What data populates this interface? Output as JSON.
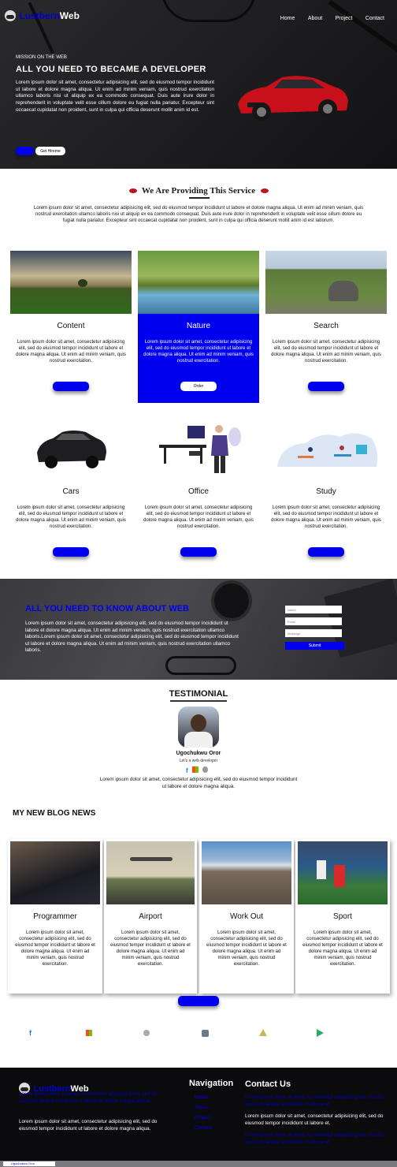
{
  "brand": {
    "part1": "Lustbern",
    "part2": "Web"
  },
  "nav": {
    "items": [
      "Home",
      "About",
      "Project",
      "Contact"
    ]
  },
  "hero": {
    "eyebrow": "MISSION ON THE WEB",
    "title": "ALL YOU NEED TO BECAME A DEVELOPER",
    "paragraph": "Lorem ipsum dolor sit amet, consectetur adipisicing elit, sed do eiusmod tempor incididunt ut labore et dolore magna aliqua. Ut enim ad minim veniam, quis nostrud exercitation ullamco laboris nisi ut aliquip ex ea commodo consequat. Duis aute irure dolor in reprehenderit in voluptate velit esse cillum dolore eu fugiat nulla pariatur. Excepteur sint occaecat cupidatat non proident, sunt in culpa qui officia deserunt mollit anim id est.",
    "secondary_button": "Get Hireme"
  },
  "services": {
    "title": "We Are Providing This Service",
    "intro": "Lorem ipsum dolor sit amet, consectetur adipisicing elit, sed do eiusmod tempor incididunt ut labore et dolore magna aliqua. Ut enim ad minim veniam, quis nostrud exercitation ullamco laboris nisi ut aliquip ex ea commodo consequat. Duis aute irure dolor in reprehenderit in voluptate velit esse cillum dolore eu fugiat nulla pariatur. Excepteur sint occaecat cupidatat non proident, sunt in culpa qui officia deserunt mollit anim id est laborum.",
    "cards": [
      {
        "title": "Content",
        "text": "Lorem ipsum dolor sit amet, consectetur adipisicing elit, sed do eiusmod tempor incididunt ut labore et dolore magna aliqua. Ut enim ad minim veniam, quis nostrud exercitation."
      },
      {
        "title": "Nature",
        "text": "Lorem ipsum dolor sit amet, consectetur adipisicing elit, sed do eiusmod tempor incididunt ut labore et dolore magna aliqua. Ut enim ad minim veniam, quis nostrud exercitation.",
        "button": "Order"
      },
      {
        "title": "Search",
        "text": "Lorem ipsum dolor sit amet, consectetur adipisicing elit, sed do eiusmod tempor incididunt ut labore et dolore magna aliqua. Ut enim ad minim veniam, quis nostrud exercitation."
      },
      {
        "title": "Cars",
        "text": "Lorem ipsum dolor sit amet, consectetur adipisicing elit, sed do eiusmod tempor incididunt ut labore et dolore magna aliqua. Ut enim ad minim veniam, quis nostrud exercitation."
      },
      {
        "title": "Office",
        "text": "Lorem ipsum dolor sit amet, consectetur adipisicing elit, sed do eiusmod tempor incididunt ut labore et dolore magna aliqua. Ut enim ad minim veniam, quis nostrud exercitation."
      },
      {
        "title": "Study",
        "text": "Lorem ipsum dolor sit amet, consectetur adipisicing elit, sed do eiusmod tempor incididunt ut labore et dolore magna aliqua. Ut enim ad minim veniam, quis nostrud exercitation."
      }
    ]
  },
  "know": {
    "title": "ALL YOU NEED TO KNOW ABOUT WEB",
    "paragraph": "Lorem ipsum dolor sit amet, consectetur adipisicing elit, sed do eiusmod tempor incididunt ut labore et dolore magna aliqua. Ut enim ad minim veniam, quis nostrud exercitation ullamco laboris.Lorem ipsum dolor sit amet, consectetur adipisicing elit, sed do eiusmod tempor incididunt ut labore et dolore magna aliqua. Ut enim ad minim veniam, quis nostrud exercitation ullamco laboris.",
    "form": {
      "field1": "Name",
      "field2": "Email",
      "field3": "Message",
      "submit": "Submit"
    }
  },
  "testimonial": {
    "title": "TESTIMONIAL",
    "name": "Ugochukwu Oror",
    "role": "Let's a web developer",
    "quote": "Lorem ipsum dolor sit amet, consectetur adipisicing elit, sed do eiusmod tempor incididunt ut labore et dolore magna aliqua."
  },
  "blog": {
    "title": "MY NEW BLOG NEWS",
    "cards": [
      {
        "title": "Programmer",
        "text": "Lorem ipsum dolor sit amet, consectetur adipisicing elit, sed do eiusmod tempor incididunt ut labore et dolore magna aliqua. Ut enim ad minim veniam, quis nostrud exercitation."
      },
      {
        "title": "Airport",
        "text": "Lorem ipsum dolor sit amet, consectetur adipisicing elit, sed do eiusmod tempor incididunt ut labore et dolore magna aliqua. Ut enim ad minim veniam, quis nostrud exercitation."
      },
      {
        "title": "Work Out",
        "text": "Lorem ipsum dolor sit amet, consectetur adipisicing elit, sed do eiusmod tempor incididunt ut labore et dolore magna aliqua. Ut enim ad minim veniam, quis nostrud exercitation."
      },
      {
        "title": "Sport",
        "text": "Lorem ipsum dolor sit amet, consectetur adipisicing elit, sed do eiusmod tempor incididunt ut labore et dolore magna aliqua. Ut enim ad minim veniam, quis nostrud exercitation."
      }
    ]
  },
  "footer": {
    "about_dim": "Lorem ipsum dolor sit amet, consectetur adipisicing elit, sed do eiusmod tempor incididunt ut labore et dolore magna aliqua.",
    "about": "Lorem ipsum dolor sit amet, consectetur adipisicing elit, sed do eiusmod tempor incididunt ut labore et dolore magna aliqua.",
    "nav_title": "Navigation",
    "nav_items": [
      "Home",
      "About",
      "Project",
      "Contact"
    ],
    "contact_title": "Contact Us",
    "contact_dim1": "Lorem ipsum dolor sit amet, consectetur adipisicing elit, sed do eiusmod tempor incididunt ut labore et.",
    "contact": "Lorem ipsum dolor sit amet, consectetur adipisicing elit, sed do eiusmod tempor incididunt ut labore et.",
    "contact_dim2": "Lorem ipsum dolor sit amet, consectetur adipisicing elit, sed do eiusmod tempor incididunt ut labore et.",
    "credit": "Ugochukwu Oror"
  },
  "colors": {
    "accent": "#0000ee",
    "dark": "#111111"
  }
}
